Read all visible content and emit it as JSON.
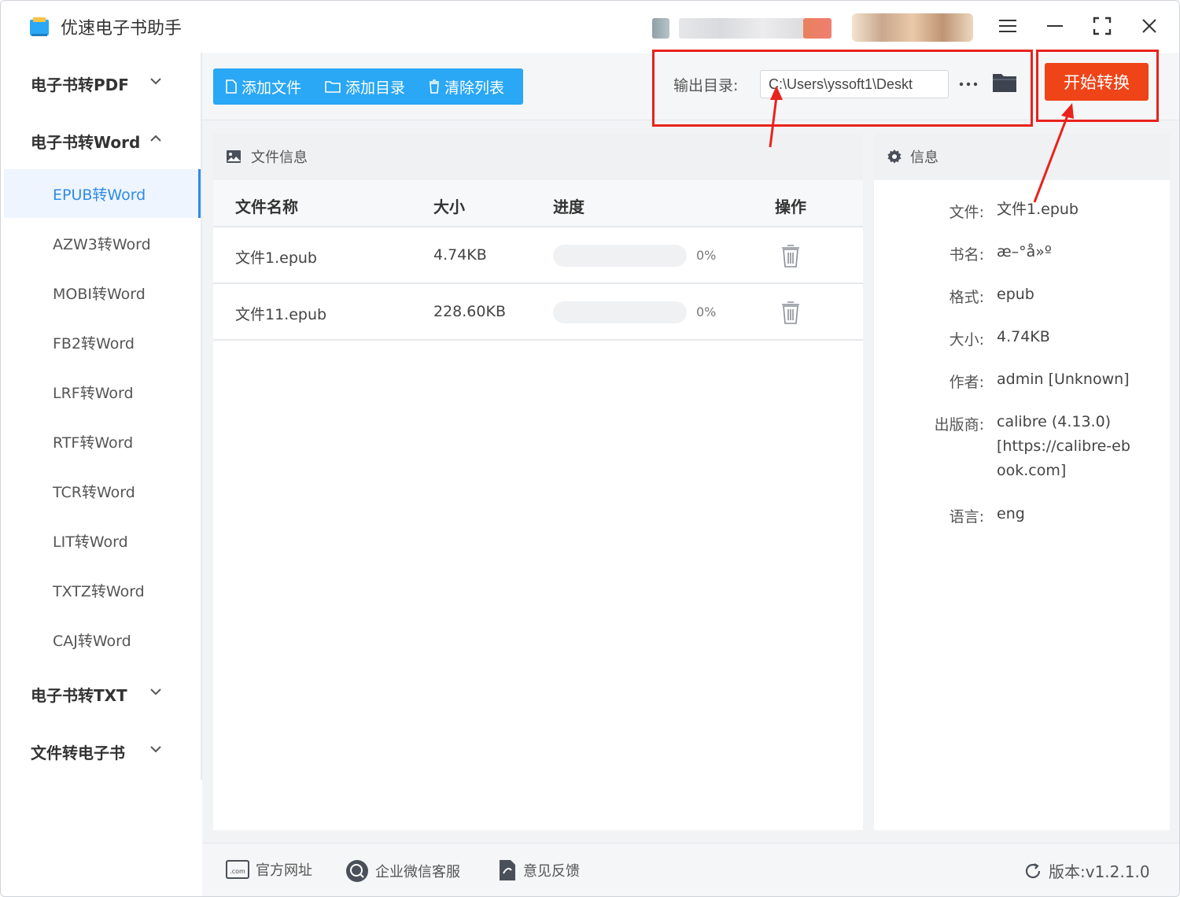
{
  "app": {
    "title": "优速电子书助手"
  },
  "sidebar": {
    "groups": [
      {
        "label": "电子书转PDF",
        "expanded": false
      },
      {
        "label": "电子书转Word",
        "expanded": true,
        "items": [
          "EPUB转Word",
          "AZW3转Word",
          "MOBI转Word",
          "FB2转Word",
          "LRF转Word",
          "RTF转Word",
          "TCR转Word",
          "LIT转Word",
          "TXTZ转Word",
          "CAJ转Word"
        ],
        "active_item": "EPUB转Word"
      },
      {
        "label": "电子书转TXT",
        "expanded": false
      },
      {
        "label": "文件转电子书",
        "expanded": false
      }
    ]
  },
  "toolbar": {
    "add_file": "添加文件",
    "add_dir": "添加目录",
    "clear_list": "清除列表",
    "output_label": "输出目录:",
    "output_path": "C:\\Users\\yssoft1\\Deskt",
    "start": "开始转换"
  },
  "file_panel": {
    "title": "文件信息",
    "columns": [
      "文件名称",
      "大小",
      "进度",
      "操作"
    ],
    "rows": [
      {
        "name": "文件1.epub",
        "size": "4.74KB",
        "progress": 0,
        "progress_text": "0%"
      },
      {
        "name": "文件11.epub",
        "size": "228.60KB",
        "progress": 0,
        "progress_text": "0%"
      }
    ]
  },
  "info_panel": {
    "title": "信息",
    "fields": [
      {
        "key": "文件:",
        "value": "文件1.epub"
      },
      {
        "key": "书名:",
        "value": "æ–°å»º"
      },
      {
        "key": "格式:",
        "value": "epub"
      },
      {
        "key": "大小:",
        "value": "4.74KB"
      },
      {
        "key": "作者:",
        "value": "admin [Unknown]"
      },
      {
        "key": "出版商:",
        "value": "calibre (4.13.0) [https://calibre-ebook.com]"
      },
      {
        "key": "语言:",
        "value": "eng"
      }
    ]
  },
  "footer": {
    "website": "官方网址",
    "wechat": "企业微信客服",
    "feedback": "意见反馈",
    "version": "版本:v1.2.1.0"
  },
  "colors": {
    "accent_blue": "#2aa7f5",
    "start_orange": "#ee4418",
    "annotation_red": "#e8231c"
  },
  "icons": [
    "app-logo-icon",
    "menu-icon",
    "minimize-icon",
    "maximize-icon",
    "close-icon",
    "chevron-down-icon",
    "chevron-up-icon",
    "file-icon",
    "folder-icon",
    "trash-icon",
    "image-icon",
    "gear-icon",
    "more-icon",
    "open-folder-icon",
    "web-icon",
    "chat-icon",
    "feedback-icon",
    "refresh-icon"
  ]
}
